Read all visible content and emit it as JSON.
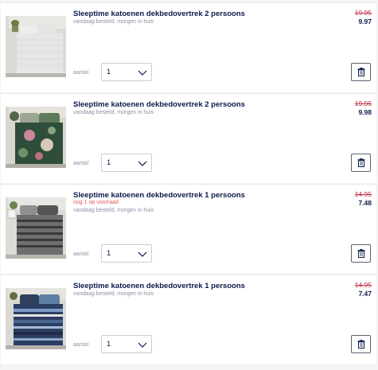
{
  "cart": {
    "items": [
      {
        "title": "Sleeptime katoenen dekbedovertrek 2 persoons",
        "stock_warning": "",
        "delivery": "vandaag besteld, morgen in huis",
        "price_old": "19.95",
        "price_new": "9.97",
        "qty_label": "aantal",
        "qty_value": "1",
        "image": "white-bedding-photo"
      },
      {
        "title": "Sleeptime katoenen dekbedovertrek 2 persoons",
        "stock_warning": "",
        "delivery": "vandaag besteld, morgen in huis",
        "price_old": "19.95",
        "price_new": "9.98",
        "qty_label": "aantal",
        "qty_value": "1",
        "image": "green-floral-bedding-photo"
      },
      {
        "title": "Sleeptime katoenen dekbedovertrek 1 persoons",
        "stock_warning": "nog 1 op voorraad",
        "delivery": "vandaag besteld, morgen in huis",
        "price_old": "14.95",
        "price_new": "7.48",
        "qty_label": "aantal",
        "qty_value": "1",
        "image": "grey-pattern-bedding-photo"
      },
      {
        "title": "Sleeptime katoenen dekbedovertrek 1 persoons",
        "stock_warning": "",
        "delivery": "vandaag besteld, morgen in huis",
        "price_old": "14.95",
        "price_new": "7.47",
        "qty_label": "aantal",
        "qty_value": "1",
        "image": "blue-stripe-bedding-photo"
      }
    ]
  },
  "icons": {
    "dropdown": "chevron-down-icon",
    "delete": "trash-icon"
  },
  "colors": {
    "title": "#0a1a4a",
    "old_price": "#c0324a",
    "stock_warning": "#e05a5a",
    "muted": "#8a91a3"
  }
}
